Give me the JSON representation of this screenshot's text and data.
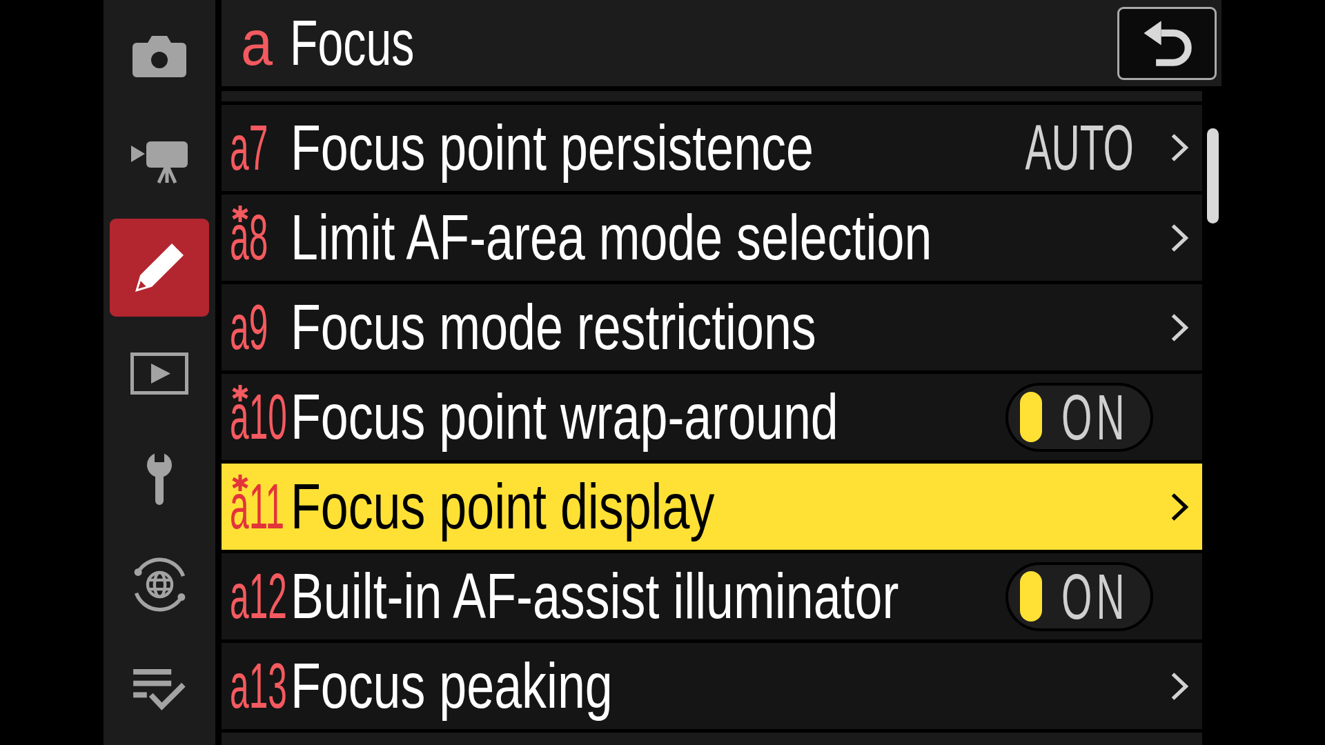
{
  "sidebar": {
    "items": [
      {
        "selected": false
      },
      {
        "selected": false
      },
      {
        "selected": true
      },
      {
        "selected": false
      },
      {
        "selected": false
      },
      {
        "selected": false
      },
      {
        "selected": false
      }
    ]
  },
  "header": {
    "code": "a",
    "title": "Focus"
  },
  "rows": [
    {
      "code": "a7",
      "modified": false,
      "label": "Focus point persistence",
      "kind": "submenu",
      "value": "AUTO",
      "selected": false
    },
    {
      "code": "a8",
      "modified": true,
      "label": "Limit AF-area mode selection",
      "kind": "submenu",
      "selected": false
    },
    {
      "code": "a9",
      "modified": false,
      "label": "Focus mode restrictions",
      "kind": "submenu",
      "selected": false
    },
    {
      "code": "a10",
      "modified": true,
      "label": "Focus point wrap-around",
      "kind": "toggle",
      "on": true,
      "value": "ON",
      "selected": false
    },
    {
      "code": "a11",
      "modified": true,
      "label": "Focus point display",
      "kind": "submenu",
      "selected": true
    },
    {
      "code": "a12",
      "modified": false,
      "label": "Built-in AF-assist illuminator",
      "kind": "toggle",
      "on": true,
      "value": "ON",
      "selected": false
    },
    {
      "code": "a13",
      "modified": false,
      "label": "Focus peaking",
      "kind": "submenu",
      "selected": false
    }
  ]
}
